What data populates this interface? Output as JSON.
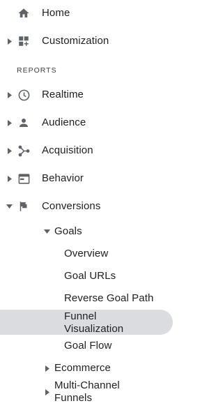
{
  "nav": {
    "home": "Home",
    "customization": "Customization",
    "section_reports": "REPORTS",
    "realtime": "Realtime",
    "audience": "Audience",
    "acquisition": "Acquisition",
    "behavior": "Behavior",
    "conversions": "Conversions",
    "goals": {
      "label": "Goals",
      "items": {
        "overview": "Overview",
        "goal_urls": "Goal URLs",
        "reverse_goal_path": "Reverse Goal Path",
        "funnel_line1": "Funnel",
        "funnel_line2": "Visualization",
        "goal_flow": "Goal Flow"
      }
    },
    "ecommerce": "Ecommerce",
    "multichannel_line1": "Multi-Channel",
    "multichannel_line2": "Funnels"
  },
  "selected_item": "Funnel Visualization",
  "colors": {
    "icon": "#5f6368",
    "text": "#202124",
    "selected_bg": "#dadce0"
  }
}
